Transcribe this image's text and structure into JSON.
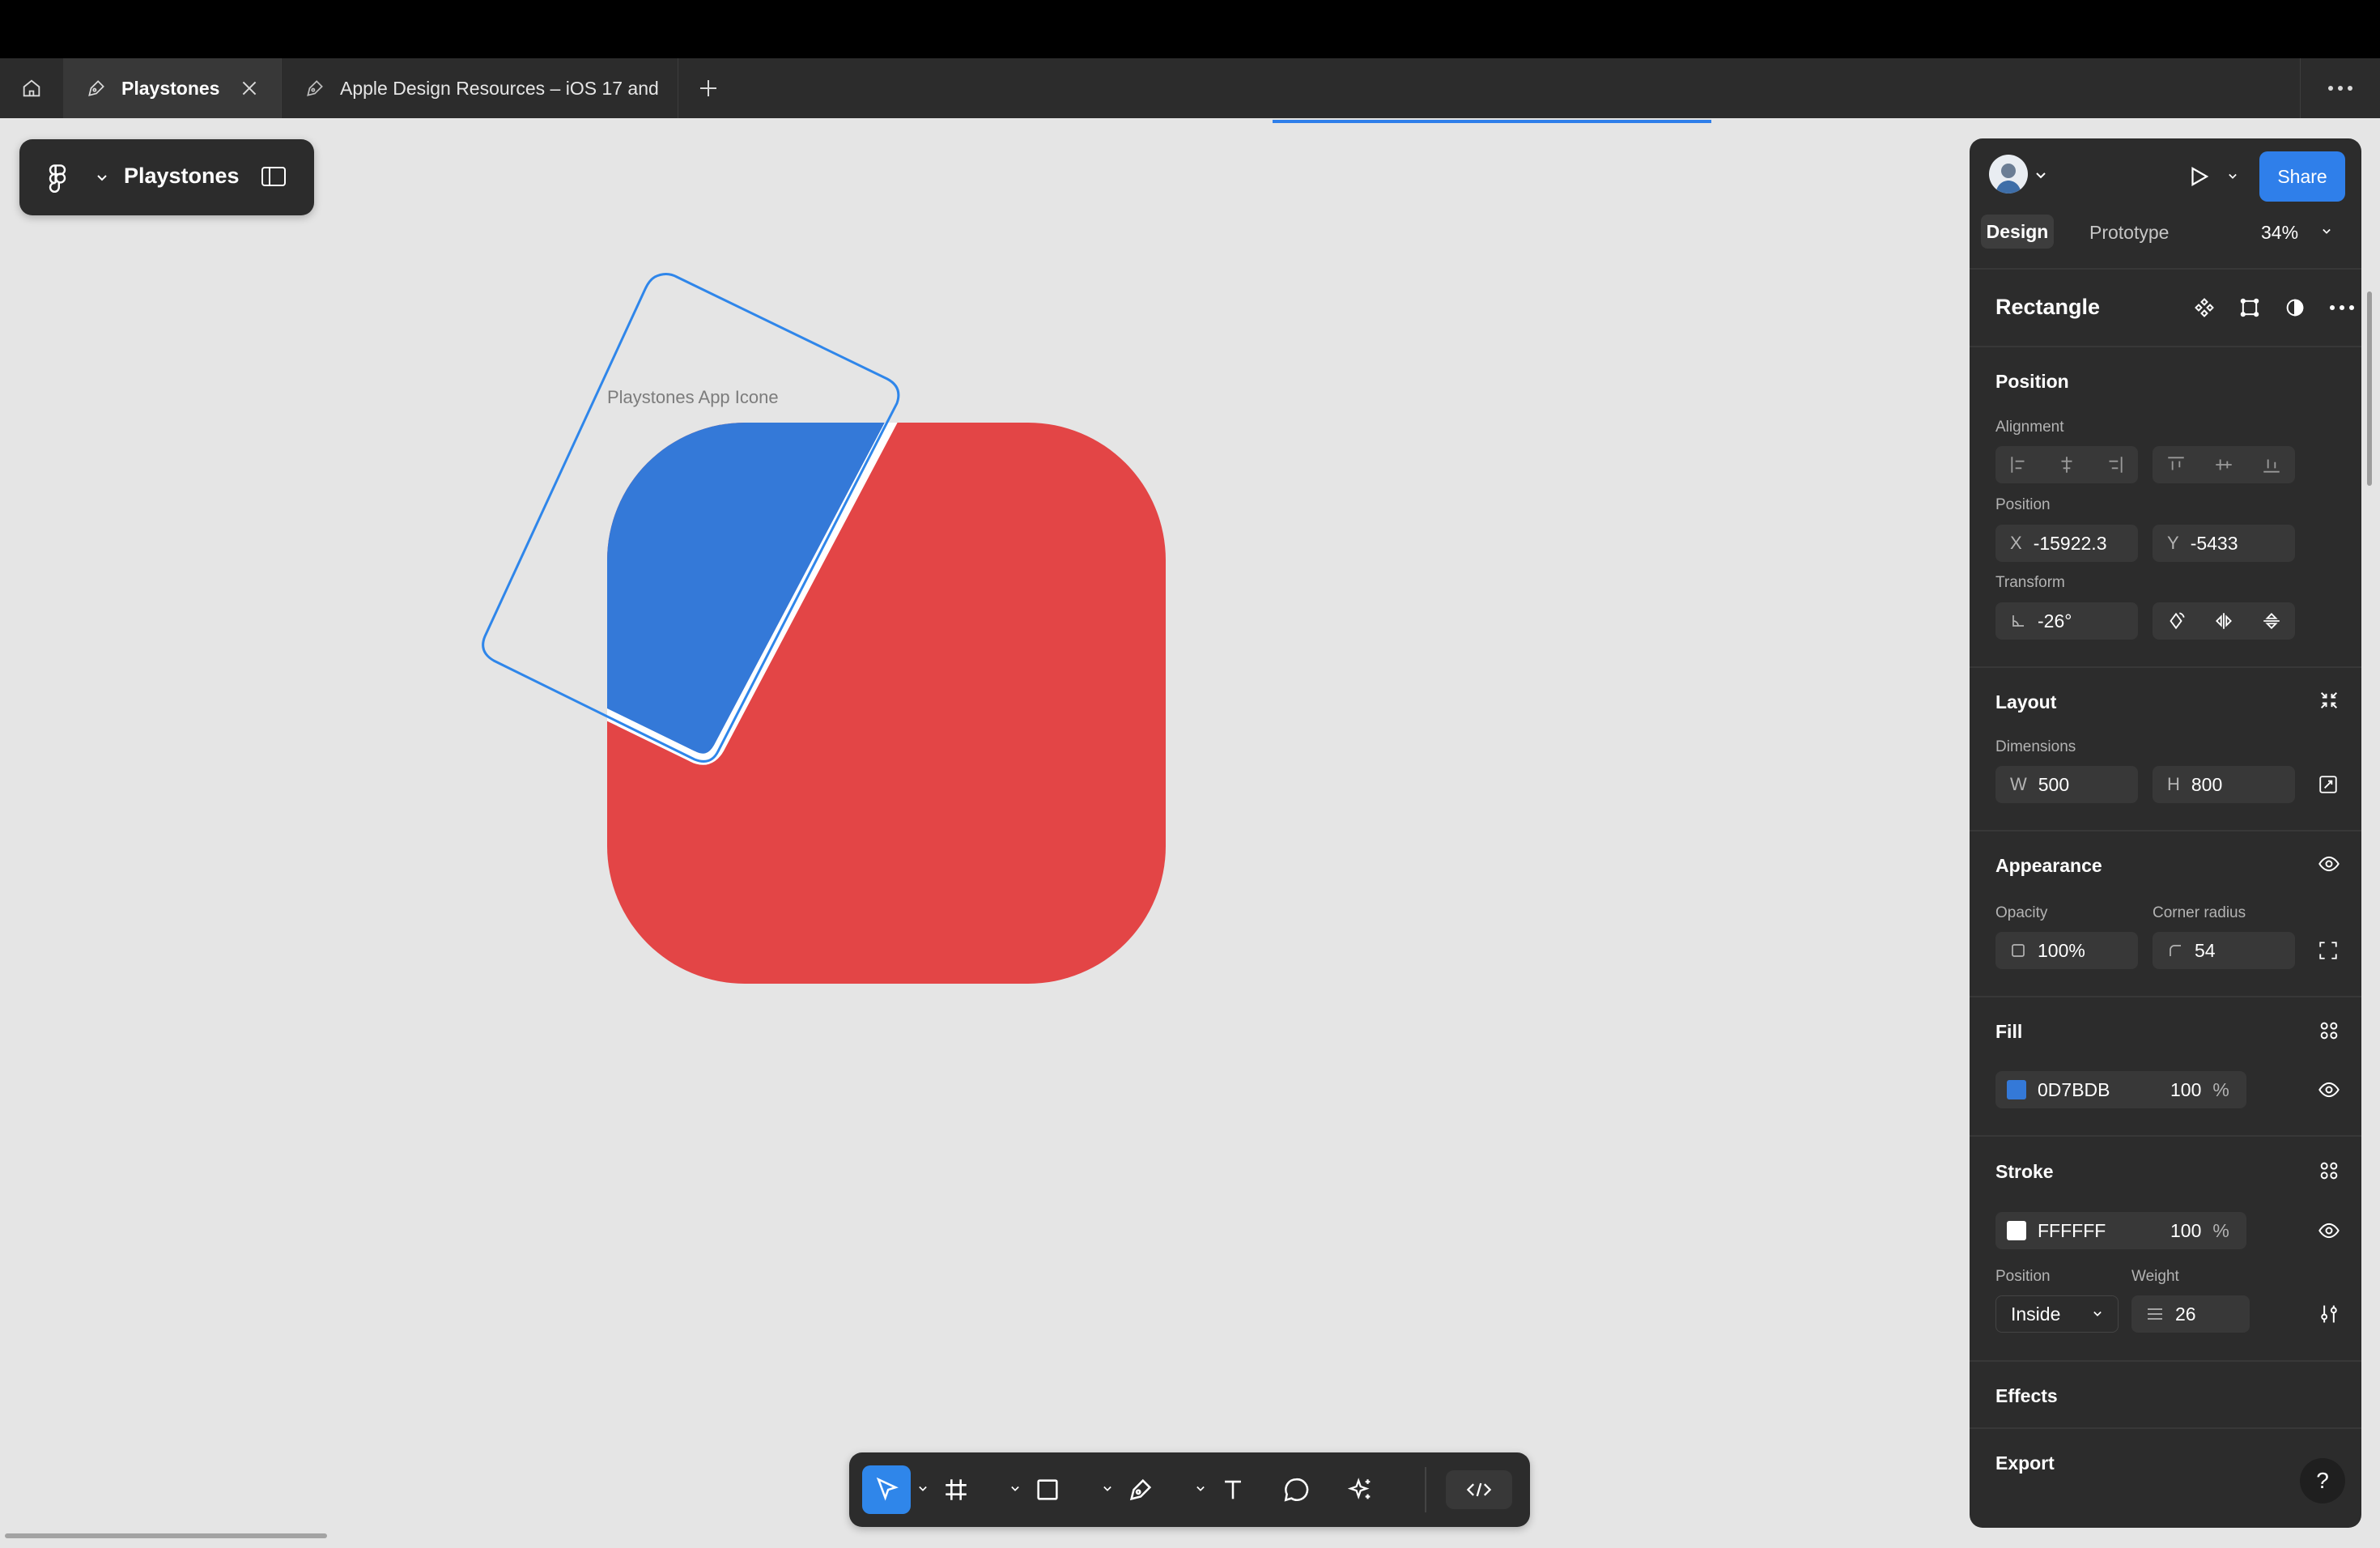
{
  "tabs": [
    {
      "label": "Playstones"
    },
    {
      "label": "Apple Design Resources – iOS 17 and"
    }
  ],
  "file": {
    "name": "Playstones"
  },
  "canvas": {
    "frame_label": "Playstones App Icone",
    "background_color": "#e5e5e5",
    "shape_colors": {
      "red": "#e34546",
      "blue": "#3479d8",
      "selection": "#2f86ea"
    }
  },
  "toolbar": {
    "tools": [
      "move-tool",
      "frame-tool",
      "shape-tool",
      "pen-tool",
      "text-tool",
      "comment-tool",
      "actions-tool",
      "dev-mode-toggle"
    ],
    "active": "move-tool"
  },
  "panel": {
    "share_label": "Share",
    "design_tab": "Design",
    "prototype_tab": "Prototype",
    "zoom": "34%",
    "layer_type": "Rectangle",
    "position": {
      "title": "Position",
      "alignment_label": "Alignment",
      "position_label": "Position",
      "x_prefix": "X",
      "x": "-15922.3",
      "y_prefix": "Y",
      "y": "-5433",
      "transform_label": "Transform",
      "rotation": "-26°"
    },
    "layout": {
      "title": "Layout",
      "dimensions_label": "Dimensions",
      "w_prefix": "W",
      "w": "500",
      "h_prefix": "H",
      "h": "800"
    },
    "appearance": {
      "title": "Appearance",
      "opacity_label": "Opacity",
      "opacity": "100%",
      "radius_label": "Corner radius",
      "radius": "54"
    },
    "fill": {
      "title": "Fill",
      "hex": "0D7BDB",
      "opacity": "100",
      "unit": "%",
      "swatch_color": "#3479d8"
    },
    "stroke": {
      "title": "Stroke",
      "hex": "FFFFFF",
      "opacity": "100",
      "unit": "%",
      "swatch_color": "#ffffff",
      "position_label": "Position",
      "position_value": "Inside",
      "weight_label": "Weight",
      "weight": "26"
    },
    "effects": {
      "title": "Effects"
    },
    "export": {
      "title": "Export"
    },
    "help": "?"
  }
}
